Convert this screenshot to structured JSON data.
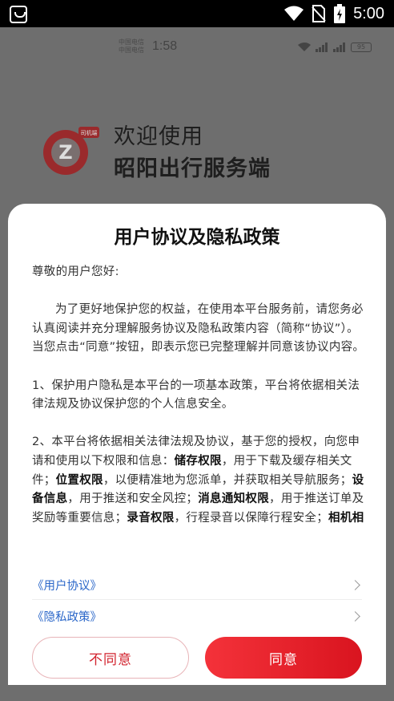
{
  "system_status": {
    "time": "5:00"
  },
  "background": {
    "carrier_1": "中国电信",
    "carrier_2": "中国电信",
    "time": "1:58",
    "battery": "95",
    "welcome_line1": "欢迎使用",
    "welcome_line2": "昭阳出行服务端",
    "logo_badge": "司机端"
  },
  "dialog": {
    "title": "用户协议及隐私政策",
    "greeting": "尊敬的用户您好:",
    "para1": "为了更好地保护您的权益，在使用本平台服务前，请您务必认真阅读并充分理解服务协议及隐私政策内容（简称“协议”）。当您点击“同意”按钮，即表示您已完整理解并同意该协议内容。",
    "para2": "1、保护用户隐私是本平台的一项基本政策，平台将依据相关法律法规及协议保护您的个人信息安全。",
    "para3": {
      "t1": "2、本平台将依据相关法律法规及协议，基于您的授权，向您申请和使用以下权限和信息：",
      "b1": "储存权限",
      "t2": "，用于下载及缓存相关文件；",
      "b2": "位置权限",
      "t3": "，以便精准地为您派单，并获取相关导航服务；",
      "b3": "设备信息",
      "t4": "，用于推送和安全风控；",
      "b4": "消息通知权限",
      "t5": "，用于推送订单及奖励等重要信息；",
      "b5": "录音权限",
      "t6": "，行程录音以保障行程安全；",
      "b6": "相机相册权"
    },
    "link_user_agreement": "《用户协议》",
    "link_privacy_policy": "《隐私政策》",
    "disagree_label": "不同意",
    "agree_label": "同意"
  },
  "colors": {
    "accent": "#e3222c",
    "link": "#2b67c9"
  }
}
